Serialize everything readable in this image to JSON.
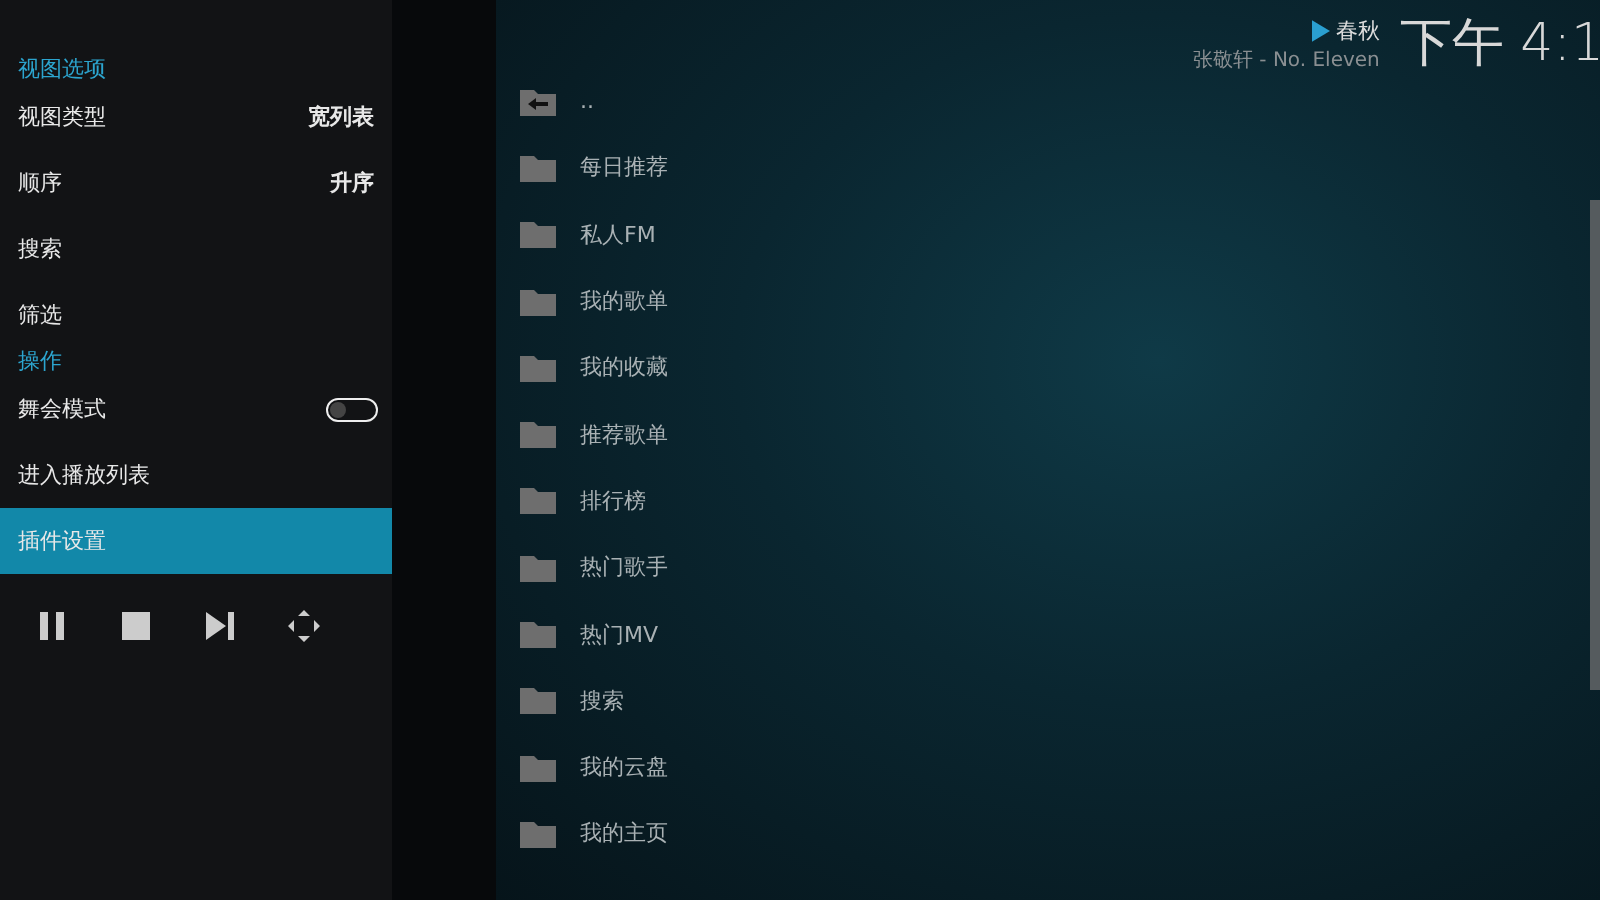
{
  "now_playing": {
    "title": "春秋",
    "subtitle": "张敬轩 - No. Eleven"
  },
  "clock": "下午 4:1",
  "side_menu": {
    "sections": [
      {
        "heading": "视图选项",
        "items": [
          {
            "kind": "value",
            "label": "视图类型",
            "value": "宽列表",
            "selected": false
          },
          {
            "kind": "value",
            "label": "顺序",
            "value": "升序",
            "selected": false
          },
          {
            "kind": "plain",
            "label": "搜索",
            "selected": false
          },
          {
            "kind": "plain",
            "label": "筛选",
            "selected": false
          }
        ]
      },
      {
        "heading": "操作",
        "items": [
          {
            "kind": "toggle",
            "label": "舞会模式",
            "on": false,
            "selected": false
          },
          {
            "kind": "plain",
            "label": "进入播放列表",
            "selected": false
          },
          {
            "kind": "plain",
            "label": "插件设置",
            "selected": true
          }
        ]
      }
    ],
    "controls": [
      {
        "kind": "pause"
      },
      {
        "kind": "stop"
      },
      {
        "kind": "next"
      },
      {
        "kind": "fullscreen"
      }
    ]
  },
  "file_list": [
    {
      "kind": "parent",
      "label": ".."
    },
    {
      "kind": "folder",
      "label": "每日推荐"
    },
    {
      "kind": "folder",
      "label": "私人FM"
    },
    {
      "kind": "folder",
      "label": "我的歌单"
    },
    {
      "kind": "folder",
      "label": "我的收藏"
    },
    {
      "kind": "folder",
      "label": "推荐歌单"
    },
    {
      "kind": "folder",
      "label": "排行榜"
    },
    {
      "kind": "folder",
      "label": "热门歌手"
    },
    {
      "kind": "folder",
      "label": "热门MV"
    },
    {
      "kind": "folder",
      "label": "搜索"
    },
    {
      "kind": "folder",
      "label": "我的云盘"
    },
    {
      "kind": "folder",
      "label": "我的主页"
    }
  ]
}
